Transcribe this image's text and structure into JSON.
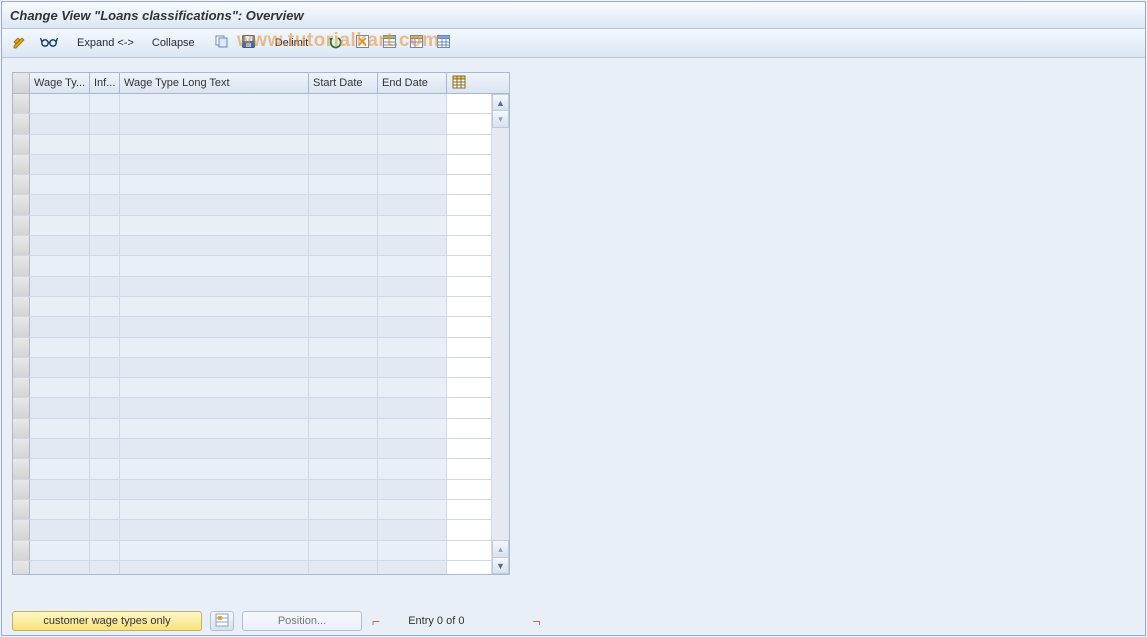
{
  "titlebar": {
    "title": "Change View \"Loans classifications\": Overview"
  },
  "toolbar": {
    "expand_label": "Expand <->",
    "collapse_label": "Collapse",
    "delimit_label": "Delimit"
  },
  "watermark": "www.tutorialkart.com",
  "grid": {
    "columns": {
      "wage_type": "Wage Ty...",
      "inf": "Inf...",
      "long_text": "Wage Type Long Text",
      "start_date": "Start Date",
      "end_date": "End Date"
    },
    "row_count": 24,
    "rows": []
  },
  "footer": {
    "customer_btn": "customer wage types only",
    "position_btn": "Position...",
    "entry_text": "Entry 0 of 0"
  },
  "icons": {
    "pencil_stack": "pencil-stack-icon",
    "glasses": "glasses-icon",
    "copy": "copy-icon",
    "save": "save-icon",
    "undo": "undo-icon",
    "select_all": "select-all-icon",
    "table1": "table-settings-icon",
    "table2": "table-variant-icon",
    "table3": "table-export-icon",
    "config": "grid-config-icon",
    "lookup": "position-lookup-icon"
  }
}
